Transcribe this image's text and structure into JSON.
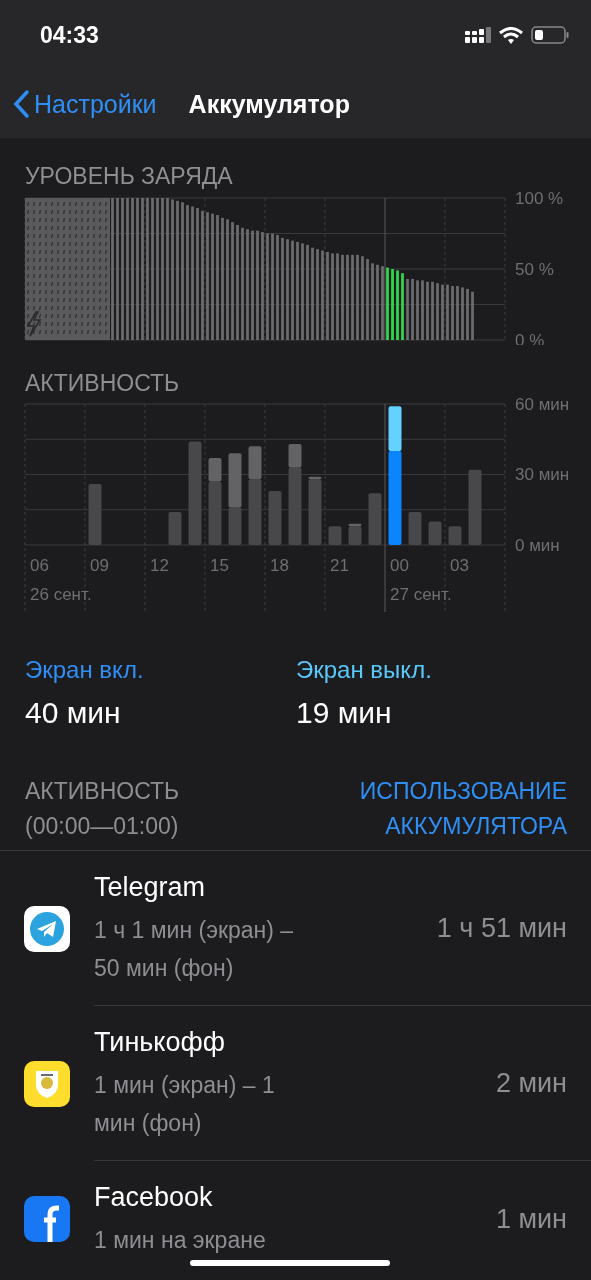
{
  "status_bar": {
    "time": "04:33"
  },
  "nav": {
    "back": "Настройки",
    "title": "Аккумулятор"
  },
  "battery_level": {
    "title": "УРОВЕНЬ ЗАРЯДА",
    "chart_data": {
      "type": "bar",
      "ylim": [
        0,
        100
      ],
      "yticks": [
        {
          "value": 100,
          "label": "100 %"
        },
        {
          "value": 50,
          "label": "50 %"
        },
        {
          "value": 0,
          "label": "0 %"
        }
      ],
      "series": [
        {
          "color": "#6c6c6e",
          "values": [
            null,
            null,
            null,
            null,
            null,
            null,
            null,
            null,
            null,
            null,
            null,
            null,
            null,
            null,
            null,
            null,
            null,
            100,
            100,
            100,
            100,
            100,
            100,
            100,
            100,
            100,
            100,
            100,
            100,
            99,
            98,
            97,
            95,
            94,
            93,
            91,
            90,
            89,
            88,
            86,
            85,
            83,
            81,
            79,
            78,
            77,
            77,
            76,
            75,
            75,
            74,
            72,
            71,
            70,
            69,
            68,
            67,
            65,
            64,
            63,
            62,
            61,
            61,
            60,
            60,
            60,
            60,
            59,
            57,
            54,
            53,
            52,
            null,
            null,
            null,
            null,
            43,
            43,
            42,
            42,
            41,
            41,
            40,
            39,
            39,
            38,
            38,
            37,
            36,
            34,
            null,
            null,
            null,
            null,
            null,
            null
          ]
        },
        {
          "color": "#32d74b",
          "values": [
            null,
            null,
            null,
            null,
            null,
            null,
            null,
            null,
            null,
            null,
            null,
            null,
            null,
            null,
            null,
            null,
            null,
            null,
            null,
            null,
            null,
            null,
            null,
            null,
            null,
            null,
            null,
            null,
            null,
            null,
            null,
            null,
            null,
            null,
            null,
            null,
            null,
            null,
            null,
            null,
            null,
            null,
            null,
            null,
            null,
            null,
            null,
            null,
            null,
            null,
            null,
            null,
            null,
            null,
            null,
            null,
            null,
            null,
            null,
            null,
            null,
            null,
            null,
            null,
            null,
            null,
            null,
            null,
            null,
            null,
            null,
            null,
            51,
            50,
            49,
            47,
            null,
            null,
            null,
            null,
            null,
            null,
            null,
            null,
            null,
            null,
            null,
            null,
            null,
            null,
            null,
            null,
            null,
            null,
            null,
            null
          ]
        }
      ]
    }
  },
  "activity": {
    "title": "АКТИВНОСТЬ",
    "chart_data": {
      "type": "bar",
      "stacked": true,
      "ylim": [
        0,
        60
      ],
      "categories": [
        "06",
        null,
        null,
        "09",
        null,
        null,
        "12",
        null,
        null,
        "15",
        null,
        null,
        "18",
        null,
        null,
        "21",
        null,
        null,
        "00",
        null,
        null,
        "03",
        null,
        null
      ],
      "yticks": [
        {
          "value": 60,
          "label": "60 мин"
        },
        {
          "value": 30,
          "label": "30 мин"
        },
        {
          "value": 0,
          "label": "0 мин"
        }
      ],
      "annotations": [
        "26 сент.",
        "27 сент."
      ],
      "series": [
        {
          "color": "#48484a",
          "values": [
            null,
            null,
            null,
            26,
            null,
            null,
            null,
            14,
            44,
            27,
            16,
            28,
            23,
            33,
            28,
            8,
            8,
            22,
            null,
            14,
            10,
            8,
            32,
            null
          ]
        },
        {
          "color": "#636366",
          "values": [
            null,
            null,
            null,
            null,
            null,
            null,
            null,
            null,
            null,
            10,
            23,
            14,
            null,
            10,
            1,
            null,
            1,
            null,
            null,
            null,
            null,
            null,
            null,
            null
          ]
        },
        {
          "color": "#0a84ff",
          "values": [
            null,
            null,
            null,
            null,
            null,
            null,
            null,
            null,
            null,
            null,
            null,
            null,
            null,
            null,
            null,
            null,
            null,
            null,
            40,
            null,
            null,
            null,
            null,
            null
          ]
        },
        {
          "color": "#64d2ff",
          "values": [
            null,
            null,
            null,
            null,
            null,
            null,
            null,
            null,
            null,
            null,
            null,
            null,
            null,
            null,
            null,
            null,
            null,
            null,
            19,
            null,
            null,
            null,
            null,
            null
          ]
        }
      ]
    }
  },
  "screen": [
    {
      "label": "Экран вкл.",
      "value": "40 мин",
      "color": "#2f8ff5"
    },
    {
      "label": "Экран выкл.",
      "value": "19 мин",
      "color": "#5ac8fa"
    }
  ],
  "usage_header": {
    "title": "АКТИВНОСТЬ",
    "range": "(00:00—01:00)",
    "link": "ИСПОЛЬЗОВАНИЕ АККУМУЛЯТОРА"
  },
  "apps": [
    {
      "kind": "telegram",
      "name": "Telegram",
      "detail": "1 ч 1 мин (экран) – 50 мин (фон)",
      "time": "1 ч 51 мин"
    },
    {
      "kind": "tinkoff",
      "name": "Тинькофф",
      "detail": "1 мин (экран) – 1 мин (фон)",
      "time": "2 мин"
    },
    {
      "kind": "facebook",
      "name": "Facebook",
      "detail": "1 мин на экране",
      "time": "1 мин"
    }
  ]
}
